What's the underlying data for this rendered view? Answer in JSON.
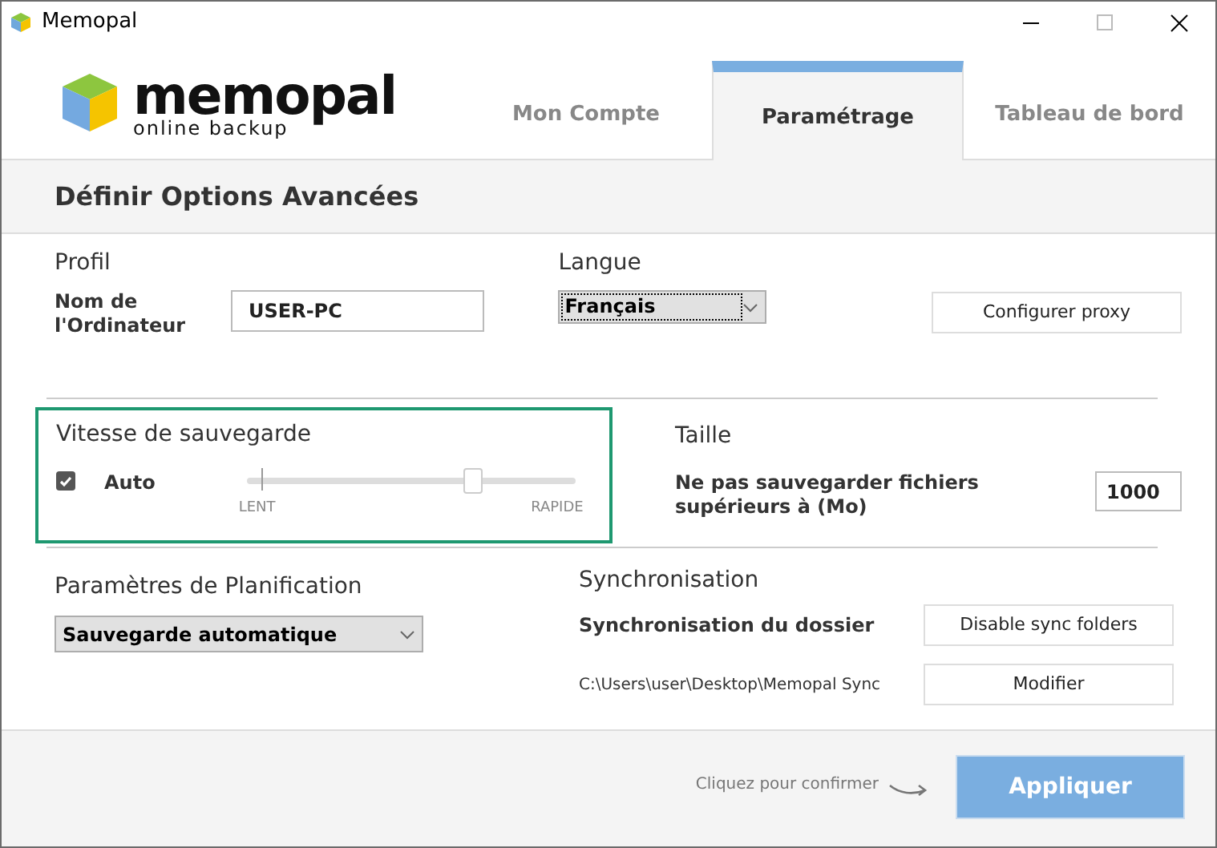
{
  "window": {
    "title": "Memopal"
  },
  "logo": {
    "name": "memopal",
    "tagline": "online backup"
  },
  "tabs": [
    {
      "label": "Mon Compte",
      "selected": false
    },
    {
      "label": "Paramétrage",
      "selected": true
    },
    {
      "label": "Tableau de bord",
      "selected": false
    }
  ],
  "heading": "Définir Options Avancées",
  "profile": {
    "title": "Profil",
    "label": "Nom de l'Ordinateur",
    "value": "USER-PC"
  },
  "language": {
    "title": "Langue",
    "value": "Français",
    "proxy_button": "Configurer proxy"
  },
  "speed": {
    "title": "Vitesse de sauvegarde",
    "auto_label": "Auto",
    "checked": true,
    "level": 0.69,
    "min_label": "LENT",
    "max_label": "RAPIDE"
  },
  "size": {
    "title": "Taille",
    "label": "Ne pas sauvegarder fichiers supérieurs à (Mo)",
    "value": "1000"
  },
  "planning": {
    "title": "Paramètres de Planification",
    "value": "Sauvegarde automatique"
  },
  "sync": {
    "title": "Synchronisation",
    "label": "Synchronisation du dossier",
    "path": "C:\\Users\\user\\Desktop\\Memopal Sync",
    "disable_button": "Disable sync folders",
    "modify_button": "Modifier"
  },
  "footer": {
    "hint": "Cliquez pour confirmer",
    "apply_button": "Appliquer"
  }
}
